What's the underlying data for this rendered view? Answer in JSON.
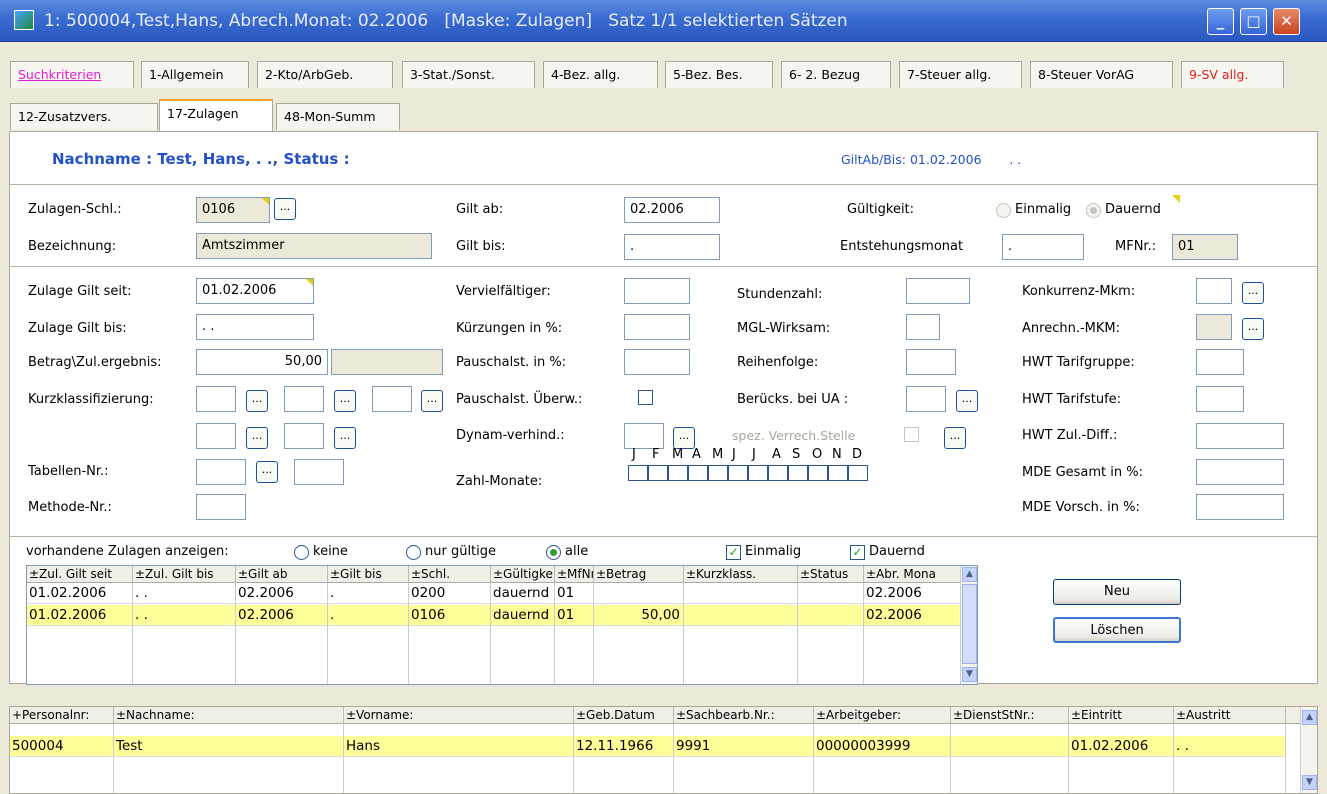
{
  "window": {
    "title": "1: 500004,Test,Hans, Abrech.Monat: 02.2006   [Maske: Zulagen]   Satz 1/1 selektierten Sätzen"
  },
  "tabs": {
    "row1": [
      "Suchkriterien",
      "1-Allgemein",
      "2-Kto/ArbGeb.",
      "3-Stat./Sonst.",
      "4-Bez. allg.",
      "5-Bez. Bes.",
      "6- 2. Bezug",
      "7-Steuer allg.",
      "8-Steuer VorAG",
      "9-SV allg."
    ],
    "row2": [
      "12-Zusatzvers.",
      "17-Zulagen",
      "48-Mon-Summ"
    ],
    "active": "17-Zulagen"
  },
  "header": {
    "name_line": "Nachname : Test,  Hans,  . .,  Status :",
    "giltab": "GiltAb/Bis: 01.02.2006       . ."
  },
  "form1": {
    "zulagen_schl_label": "Zulagen-Schl.:",
    "zulagen_schl_value": "0106",
    "bezeichnung_label": "Bezeichnung:",
    "bezeichnung_value": "Amtszimmer",
    "gilt_ab_label": "Gilt ab:",
    "gilt_ab_value": "02.2006",
    "gilt_bis_label": "Gilt bis:",
    "gilt_bis_value": ".",
    "gueltigkeit_label": "Gültigkeit:",
    "einmalig_label": "Einmalig",
    "dauernd_label": "Dauernd",
    "entstehungsmonat_label": "Entstehungsmonat",
    "entstehungsmonat_value": ".",
    "mfnr_label": "MFNr.:",
    "mfnr_value": "01"
  },
  "form2": {
    "zulage_gilt_seit_label": "Zulage Gilt seit:",
    "zulage_gilt_seit_value": "01.02.2006",
    "zulage_gilt_bis_label": "Zulage Gilt bis:",
    "zulage_gilt_bis_value": ". .",
    "betrag_label": "Betrag\\Zul.ergebnis:",
    "betrag_value": "50,00",
    "betrag_sep": "\\",
    "kurzklass_label": "Kurzklassifizierung:",
    "tabellen_label": "Tabellen-Nr.:",
    "methode_label": "Methode-Nr.:",
    "vervielf_label": "Vervielfältiger:",
    "kuerzungen_label": "Kürzungen in %:",
    "pauschalst_label": "Pauschalst. in %:",
    "pauschalst_ueberw_label": "Pauschalst. Überw.:",
    "dynam_label": "Dynam-verhind.:",
    "zahl_monate_label": "Zahl-Monate:",
    "months": [
      "J",
      "F",
      "M",
      "A",
      "M",
      "J",
      "J",
      "A",
      "S",
      "O",
      "N",
      "D"
    ],
    "stundenzahl_label": "Stundenzahl:",
    "mgl_label": "MGL-Wirksam:",
    "reihenfolge_label": "Reihenfolge:",
    "beruecks_label": "Berücks. bei UA :",
    "spez_label": "spez. Verrech.Stelle",
    "konkurrenz_label": "Konkurrenz-Mkm:",
    "anrechn_label": "Anrechn.-MKM:",
    "hwt_gruppe_label": "HWT Tarifgruppe:",
    "hwt_stufe_label": "HWT Tarifstufe:",
    "hwt_diff_label": "HWT Zul.-Diff.:",
    "mde_gesamt_label": "MDE Gesamt in %:",
    "mde_vorsch_label": "MDE Vorsch. in %:",
    "dots": "..."
  },
  "filter": {
    "label": "vorhandene Zulagen anzeigen:",
    "keine": "keine",
    "nur_gueltige": "nur gültige",
    "alle": "alle",
    "einmalig": "Einmalig",
    "dauernd": "Dauernd",
    "check_mark": "✓"
  },
  "zulagen_table": {
    "columns": [
      "±Zul. Gilt seit",
      "±Zul. Gilt bis",
      "±Gilt ab",
      "±Gilt bis",
      "±Schl.",
      "±Gültigkeit",
      "±MfNr",
      "±Betrag",
      "±Kurzklass.",
      "±Status",
      "±Abr. Mona"
    ],
    "rows": [
      [
        "01.02.2006",
        ". .",
        "02.2006",
        ".",
        "0200",
        "dauernd",
        "01",
        "",
        "",
        "",
        "02.2006"
      ],
      [
        "01.02.2006",
        ". .",
        "02.2006",
        ".",
        "0106",
        "dauernd",
        "01",
        "50,00",
        "",
        "",
        "02.2006"
      ]
    ]
  },
  "buttons": {
    "neu": "Neu",
    "loeschen": "Löschen"
  },
  "person_table": {
    "columns": [
      "+Personalnr:",
      "±Nachname:",
      "±Vorname:",
      "±Geb.Datum",
      "±Sachbearb.Nr.:",
      "±Arbeitgeber:",
      "±DienstStNr.:",
      "±Eintritt",
      "±Austritt"
    ],
    "rows": [
      [
        "500004",
        "Test",
        "Hans",
        "12.11.1966",
        "9991",
        "00000003999",
        "",
        "01.02.2006",
        ". ."
      ]
    ]
  }
}
